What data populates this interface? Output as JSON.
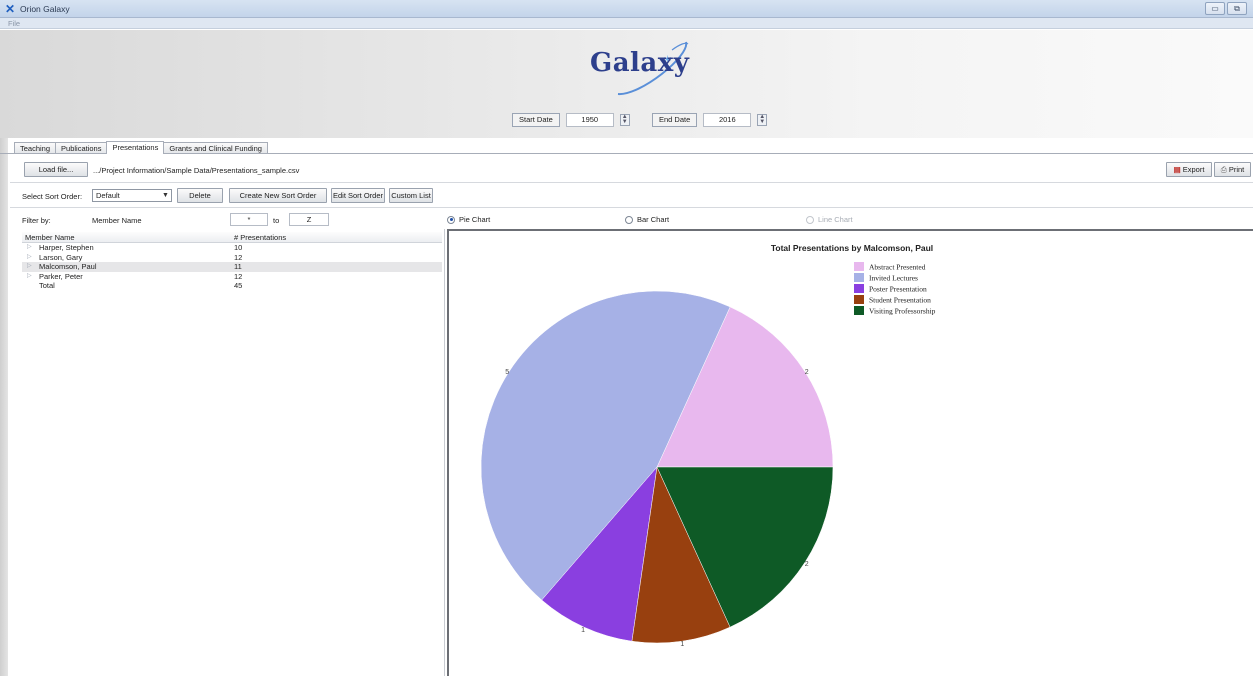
{
  "window": {
    "title": "Orion Galaxy",
    "menu": [
      "File"
    ],
    "controls": [
      "▭",
      "⧉"
    ]
  },
  "header": {
    "logo_text": "Galaxy",
    "start_date_label": "Start Date",
    "start_date_value": "1950",
    "end_date_label": "End Date",
    "end_date_value": "2016"
  },
  "tabs": [
    {
      "label": "Teaching"
    },
    {
      "label": "Publications"
    },
    {
      "label": "Presentations",
      "active": true
    },
    {
      "label": "Grants and Clinical Funding"
    }
  ],
  "toolbar": {
    "load_label": "Load file...",
    "file_path": ".../Project Information/Sample Data/Presentations_sample.csv",
    "export_label": "Export",
    "print_label": "Print"
  },
  "sort": {
    "label": "Select Sort Order:",
    "selected": "Default",
    "delete_label": "Delete",
    "create_label": "Create New Sort Order",
    "edit_label": "Edit Sort Order",
    "custom_label": "Custom List"
  },
  "filter": {
    "label": "Filter by:",
    "field": "Member Name",
    "from": "*",
    "to_label": "to",
    "to": "Z"
  },
  "table": {
    "col_name": "Member Name",
    "col_count": "# Presentations",
    "rows": [
      {
        "name": "Harper, Stephen",
        "count": "10"
      },
      {
        "name": "Larson, Gary",
        "count": "12"
      },
      {
        "name": "Malcomson, Paul",
        "count": "11",
        "selected": true
      },
      {
        "name": "Parker, Peter",
        "count": "12"
      }
    ],
    "total_label": "Total",
    "total_value": "45"
  },
  "chart_options": {
    "pie": "Pie Chart",
    "bar": "Bar Chart",
    "line": "Line Chart"
  },
  "colors": {
    "abstract": "#e8b8ee",
    "invited": "#a6b1e6",
    "poster": "#8a3fe0",
    "student": "#98400f",
    "visiting": "#0e5a26"
  },
  "chart_data": {
    "type": "pie",
    "title": "Total Presentations by Malcomson, Paul",
    "legend_position": "top-right",
    "slices": [
      {
        "label": "Abstract Presented",
        "value": 2,
        "color": "#e8b8ee"
      },
      {
        "label": "Invited Lectures",
        "value": 5,
        "color": "#a6b1e6"
      },
      {
        "label": "Poster Presentation",
        "value": 1,
        "color": "#8a3fe0"
      },
      {
        "label": "Student Presentation",
        "value": 1,
        "color": "#98400f"
      },
      {
        "label": "Visiting Professorship",
        "value": 2,
        "color": "#0e5a26"
      }
    ]
  }
}
